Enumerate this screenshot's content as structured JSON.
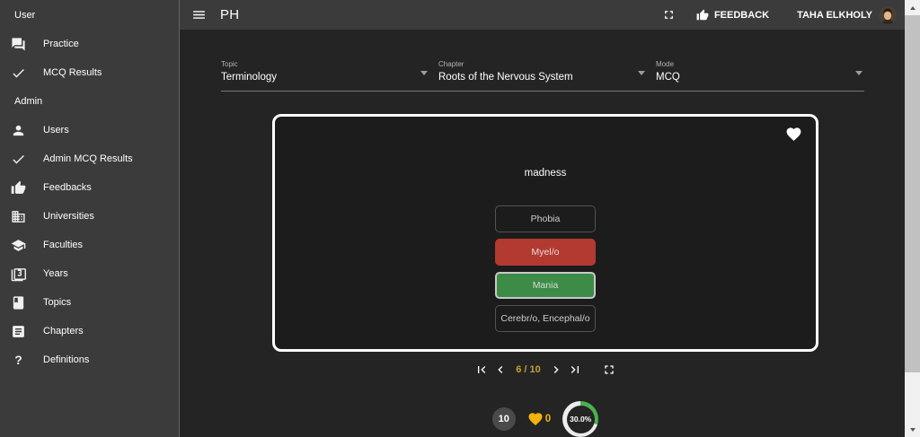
{
  "colors": {
    "accent_wrong": "#b23a31",
    "accent_correct": "#3c8c47",
    "accent_amber": "#c49f35",
    "heart_gold": "#f2b30d",
    "progress_green": "#4caf50"
  },
  "topbar": {
    "title": "PH",
    "feedback_label": "FEEDBACK",
    "user_name": "TAHA ELKHOLY"
  },
  "sidebar": {
    "sections": [
      {
        "header": "User",
        "items": [
          {
            "icon": "forum-icon",
            "label": "Practice"
          },
          {
            "icon": "check-icon",
            "label": "MCQ Results"
          }
        ]
      },
      {
        "header": "Admin",
        "items": [
          {
            "icon": "person-icon",
            "label": "Users"
          },
          {
            "icon": "check-icon",
            "label": "Admin MCQ Results"
          },
          {
            "icon": "thumb-up-icon",
            "label": "Feedbacks"
          },
          {
            "icon": "building-icon",
            "label": "Universities"
          },
          {
            "icon": "graduation-cap-icon",
            "label": "Faculties"
          },
          {
            "icon": "filter-3-icon",
            "label": "Years"
          },
          {
            "icon": "book-icon",
            "label": "Topics"
          },
          {
            "icon": "article-icon",
            "label": "Chapters"
          },
          {
            "icon": "question-mark-icon",
            "label": "Definitions"
          }
        ]
      }
    ]
  },
  "filters": [
    {
      "label": "Topic",
      "value": "Terminology"
    },
    {
      "label": "Chapter",
      "value": "Roots of the Nervous System"
    },
    {
      "label": "Mode",
      "value": "MCQ"
    }
  ],
  "quiz": {
    "question": "madness",
    "options": [
      {
        "label": "Phobia",
        "state": "default"
      },
      {
        "label": "Myel/o",
        "state": "wrong"
      },
      {
        "label": "Mania",
        "state": "correct"
      },
      {
        "label": "Cerebr/o, Encephal/o",
        "state": "default"
      }
    ],
    "pagination": {
      "display": "6 / 10",
      "current": 6,
      "total": 10
    }
  },
  "stats": {
    "question_count": "10",
    "favorites_count": "0",
    "score_text": "30.0%",
    "score_percent": 30
  }
}
